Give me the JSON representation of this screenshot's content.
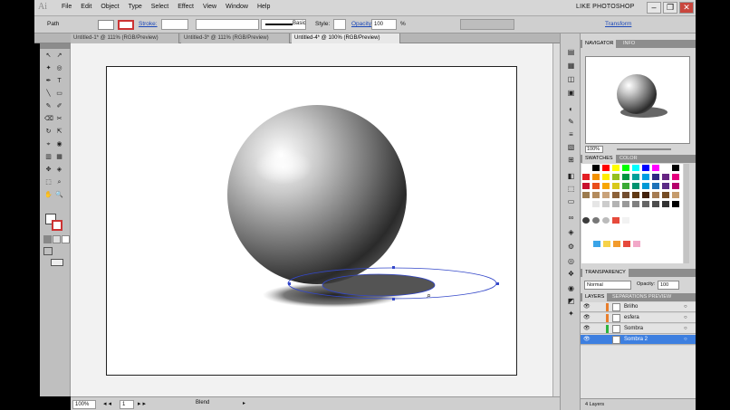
{
  "app": {
    "logo": "Ai",
    "workspace": "LIKE PHOTOSHOP"
  },
  "menu": [
    "File",
    "Edit",
    "Object",
    "Type",
    "Select",
    "Effect",
    "View",
    "Window",
    "Help"
  ],
  "window_controls": [
    "–",
    "❐",
    "✕"
  ],
  "control_bar": {
    "selection": "Path",
    "stroke_label": "Stroke:",
    "stroke_profile": "Basic",
    "style_label": "Style:",
    "opacity_label": "Opacity:",
    "opacity_value": "100",
    "opacity_unit": "%",
    "transform_link": "Transform"
  },
  "doc_tabs": [
    "Untitled-1* @ 111% (RGB/Preview)",
    "Untitled-3* @ 111% (RGB/Preview)",
    "Untitled-4* @ 100% (RGB/Preview)"
  ],
  "status_bar": {
    "zoom": "100%",
    "artboard": "1",
    "tool": "Blend"
  },
  "navigator": {
    "tabs": [
      "NAVIGATOR",
      "INFO"
    ],
    "zoom": "100%"
  },
  "swatches": {
    "tabs": [
      "SWATCHES",
      "COLOR"
    ],
    "rows": [
      [
        "#ffffff",
        "#000000",
        "#ff0000",
        "#ffff00",
        "#00ff00",
        "#00ffff",
        "#0000ff",
        "#ff00ff",
        "#ffffff",
        "#000000"
      ],
      [
        "#e31e24",
        "#f39200",
        "#ffed00",
        "#95c11f",
        "#009640",
        "#00a19a",
        "#009fe3",
        "#312783",
        "#662483",
        "#e5007d"
      ],
      [
        "#c8102e",
        "#e94e1b",
        "#f7a600",
        "#d8c91b",
        "#3aaa35",
        "#00936f",
        "#0099d6",
        "#1d71b8",
        "#5b2a86",
        "#b5006b"
      ],
      [
        "#9c7b4e",
        "#b38b5d",
        "#c9a27a",
        "#8c6239",
        "#734e30",
        "#603913",
        "#42210b",
        "#a67c52",
        "#754c24",
        "#c69c6d"
      ],
      [
        "#ffffff",
        "#e6e6e6",
        "#cccccc",
        "#b3b3b3",
        "#999999",
        "#808080",
        "#666666",
        "#4d4d4d",
        "#333333",
        "#000000"
      ]
    ],
    "patterns": [
      "#3b3b3b",
      "#777777",
      "#bbbbbb",
      "#e64a3c",
      "#f2f2f2"
    ],
    "group": [
      "#3aa4e8",
      "#f6d24a",
      "#f29b2c",
      "#e64a3c",
      "#f2a8c8"
    ]
  },
  "transparency": {
    "tabs": [
      "TRANSPARENCY"
    ],
    "mode": "Normal",
    "opacity_label": "Opacity:",
    "opacity_value": "100"
  },
  "layers": {
    "tabs": [
      "LAYERS",
      "SEPARATIONS PREVIEW"
    ],
    "items": [
      {
        "name": "Brilho",
        "color": "#e87e2c",
        "selected": false
      },
      {
        "name": "esfera",
        "color": "#e87e2c",
        "selected": false
      },
      {
        "name": "Sombra",
        "color": "#2cb43e",
        "selected": false
      },
      {
        "name": "Sombra 2",
        "color": "#3d7fe0",
        "selected": true
      }
    ],
    "count": "4 Layers"
  },
  "tools": [
    [
      "↖",
      "↗"
    ],
    [
      "✦",
      "◎"
    ],
    [
      "✒",
      "T"
    ],
    [
      "╲",
      "▭"
    ],
    [
      "✎",
      "✐"
    ],
    [
      "⌫",
      "✂"
    ],
    [
      "↻",
      "⇱"
    ],
    [
      "⌖",
      "◉"
    ],
    [
      "▥",
      "▦"
    ],
    [
      "✥",
      "◈"
    ],
    [
      "⬚",
      "⌕"
    ],
    [
      "✋",
      "🔍"
    ]
  ]
}
